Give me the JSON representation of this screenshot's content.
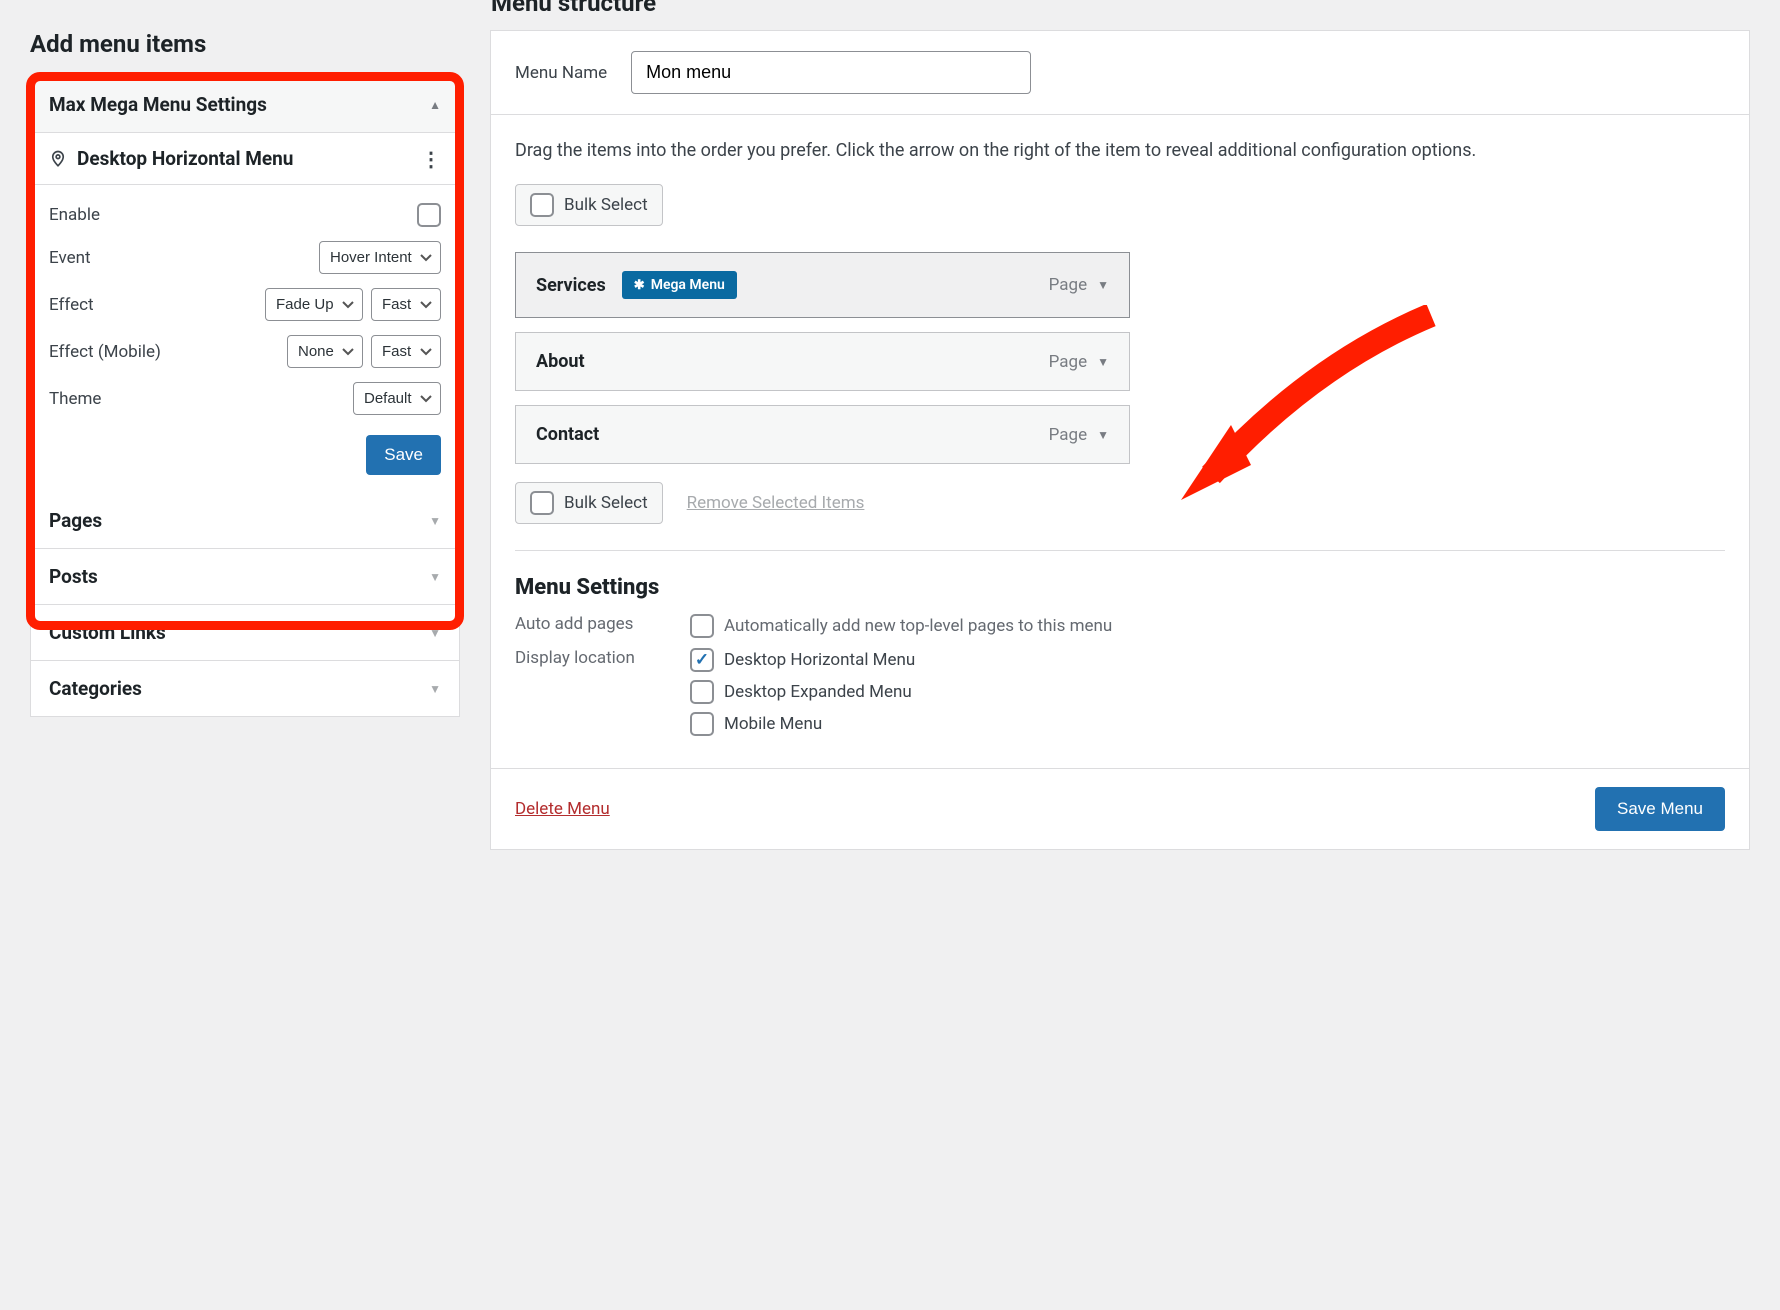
{
  "left": {
    "heading": "Add menu items",
    "mega_menu": {
      "panel_title": "Max Mega Menu Settings",
      "location_label": "Desktop Horizontal Menu",
      "rows": {
        "enable": "Enable",
        "event": "Event",
        "effect": "Effect",
        "effect_mobile": "Effect (Mobile)",
        "theme": "Theme"
      },
      "selects": {
        "event": "Hover Intent",
        "effect_type": "Fade Up",
        "effect_speed": "Fast",
        "effect_mobile_type": "None",
        "effect_mobile_speed": "Fast",
        "theme": "Default"
      },
      "save": "Save"
    },
    "accordions": [
      "Pages",
      "Posts",
      "Custom Links",
      "Categories"
    ]
  },
  "right": {
    "heading": "Menu structure",
    "menu_name_label": "Menu Name",
    "menu_name_value": "Mon menu",
    "instructions": "Drag the items into the order you prefer. Click the arrow on the right of the item to reveal additional configuration options.",
    "bulk_select": "Bulk Select",
    "remove_selected": "Remove Selected Items",
    "items": [
      {
        "title": "Services",
        "type": "Page",
        "mega": true,
        "mega_label": "Mega Menu"
      },
      {
        "title": "About",
        "type": "Page",
        "mega": false
      },
      {
        "title": "Contact",
        "type": "Page",
        "mega": false
      }
    ],
    "settings": {
      "heading": "Menu Settings",
      "auto_add_label": "Auto add pages",
      "auto_add_text": "Automatically add new top-level pages to this menu",
      "display_location_label": "Display location",
      "locations": [
        {
          "label": "Desktop Horizontal Menu",
          "checked": true
        },
        {
          "label": "Desktop Expanded Menu",
          "checked": false
        },
        {
          "label": "Mobile Menu",
          "checked": false
        }
      ]
    },
    "delete": "Delete Menu",
    "save_menu": "Save Menu"
  }
}
